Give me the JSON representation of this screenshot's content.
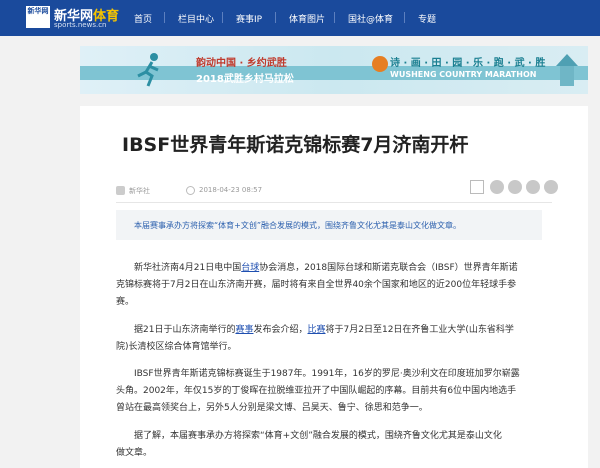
{
  "header": {
    "logo_box": "新华网",
    "logo_main": "新华网",
    "logo_sport": "体育",
    "logo_sub": "sports.news.cn",
    "nav": [
      "首页",
      "栏目中心",
      "赛事IP",
      "体育图片",
      "国社@体育",
      "专题"
    ],
    "colors": {
      "bar": "#1a4a9c",
      "accent": "#f5c400"
    }
  },
  "banner": {
    "left_line1": "韵动中国 · 乡约武胜",
    "left_line2": "2018武胜乡村马拉松",
    "right_line1": "诗 · 画 · 田 · 园 · 乐 · 跑 · 武 · 胜",
    "right_line2": "WUSHENG COUNTRY MARATHON"
  },
  "article": {
    "title": "IBSF世界青年斯诺克锦标赛7月济南开杆",
    "source": "新华社",
    "time": "2018-04-23 08:57",
    "share_icons": [
      "window-icon",
      "comment-icon",
      "weibo-icon",
      "wechat-icon",
      "more-icon"
    ],
    "summary": "本届赛事承办方将探索“体育+文创”融合发展的模式，围绕齐鲁文化尤其是泰山文化做文章。",
    "p1": {
      "l1_a": "新华社济南4月21日电中国",
      "l1_link": "台球",
      "l1_b": "协会消息，2018国际台球和斯诺克联合会（IBSF）世界青年斯诺",
      "l2": "克锦标赛将于7月2日在山东济南开赛，届时将有来自全世界40余个国家和地区的近200位年轻球手参",
      "l3": "赛。"
    },
    "p2": {
      "l1_a": "据21日于山东济南举行的",
      "l1_link1": "赛事",
      "l1_b": "发布会介绍，",
      "l1_link2": "比赛",
      "l1_c": "将于7月2日至12日在齐鲁工业大学(山东省科学",
      "l2": "院)长清校区综合体育馆举行。"
    },
    "p3": {
      "l1": "IBSF世界青年斯诺克锦标赛诞生于1987年。1991年，16岁的罗尼·奥沙利文在印度班加罗尔崭露",
      "l2": "头角。2002年，年仅15岁的丁俊晖在拉脱维亚拉开了中国队崛起的序幕。目前共有6位中国内地选手",
      "l3": "曾站在最高领奖台上，另外5人分别是梁文博、吕昊天、鲁宁、徐思和范争一。"
    },
    "p4": {
      "l1": "据了解，本届赛事承办方将探索“体育+文创”融合发展的模式，围绕齐鲁文化尤其是泰山文化",
      "l2": "做文章。"
    }
  }
}
